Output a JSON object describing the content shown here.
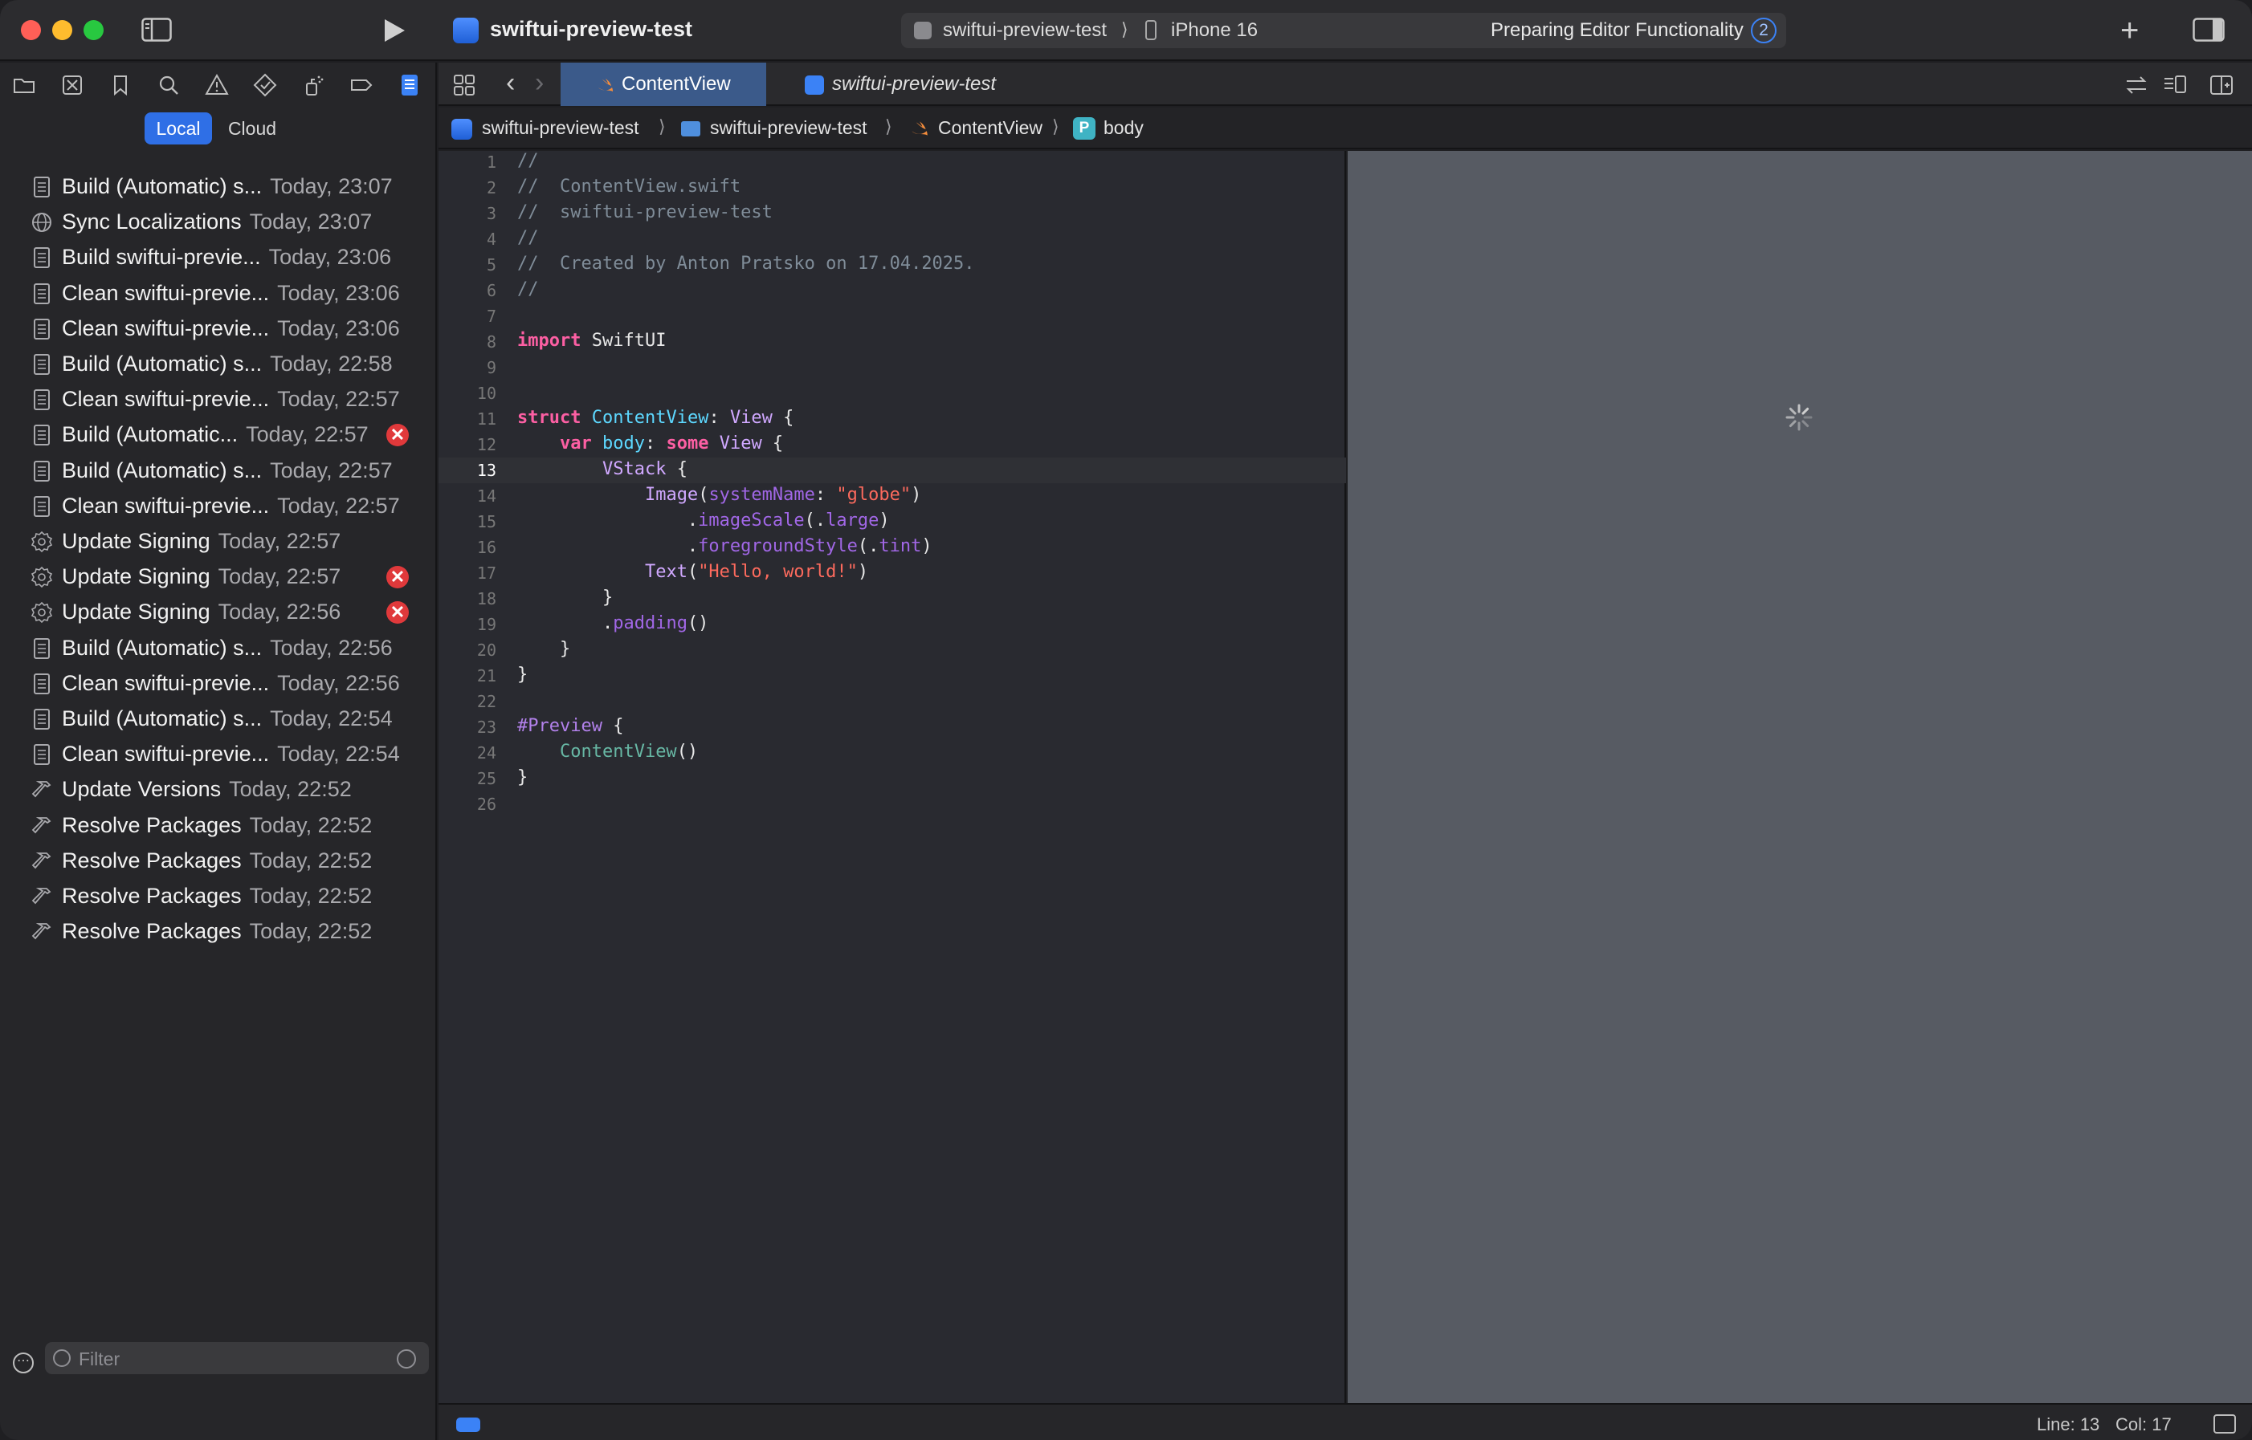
{
  "titlebar": {
    "project_title": "swiftui-preview-test",
    "scheme": "swiftui-preview-test",
    "scheme_separator": "⟩",
    "device": "iPhone 16",
    "status": "Preparing Editor Functionality",
    "status_count": "2",
    "add_symbol": "+"
  },
  "navigator": {
    "segments": {
      "local": "Local",
      "cloud": "Cloud"
    },
    "reports": [
      {
        "title": "Build (Automatic) s...",
        "time": "Today, 23:07",
        "icon": "document-icon",
        "error": false
      },
      {
        "title": "Sync Localizations",
        "time": "Today, 23:07",
        "icon": "globe-icon",
        "error": false
      },
      {
        "title": "Build swiftui-previe...",
        "time": "Today, 23:06",
        "icon": "document-icon",
        "error": false
      },
      {
        "title": "Clean swiftui-previe...",
        "time": "Today, 23:06",
        "icon": "document-icon",
        "error": false
      },
      {
        "title": "Clean swiftui-previe...",
        "time": "Today, 23:06",
        "icon": "document-icon",
        "error": false
      },
      {
        "title": "Build (Automatic) s...",
        "time": "Today, 22:58",
        "icon": "document-icon",
        "error": false
      },
      {
        "title": "Clean swiftui-previe...",
        "time": "Today, 22:57",
        "icon": "document-icon",
        "error": false
      },
      {
        "title": "Build (Automatic...",
        "time": "Today, 22:57",
        "icon": "document-icon",
        "error": true
      },
      {
        "title": "Build (Automatic) s...",
        "time": "Today, 22:57",
        "icon": "document-icon",
        "error": false
      },
      {
        "title": "Clean swiftui-previe...",
        "time": "Today, 22:57",
        "icon": "document-icon",
        "error": false
      },
      {
        "title": "Update Signing",
        "time": "Today, 22:57",
        "icon": "gear-badge-icon",
        "error": false
      },
      {
        "title": "Update Signing",
        "time": "Today, 22:57",
        "icon": "gear-badge-icon",
        "error": true
      },
      {
        "title": "Update Signing",
        "time": "Today, 22:56",
        "icon": "gear-badge-icon",
        "error": true
      },
      {
        "title": "Build (Automatic) s...",
        "time": "Today, 22:56",
        "icon": "document-icon",
        "error": false
      },
      {
        "title": "Clean swiftui-previe...",
        "time": "Today, 22:56",
        "icon": "document-icon",
        "error": false
      },
      {
        "title": "Build (Automatic) s...",
        "time": "Today, 22:54",
        "icon": "document-icon",
        "error": false
      },
      {
        "title": "Clean swiftui-previe...",
        "time": "Today, 22:54",
        "icon": "document-icon",
        "error": false
      },
      {
        "title": "Update Versions",
        "time": "Today, 22:52",
        "icon": "hammer-icon",
        "error": false
      },
      {
        "title": "Resolve Packages",
        "time": "Today, 22:52",
        "icon": "hammer-icon",
        "error": false
      },
      {
        "title": "Resolve Packages",
        "time": "Today, 22:52",
        "icon": "hammer-icon",
        "error": false
      },
      {
        "title": "Resolve Packages",
        "time": "Today, 22:52",
        "icon": "hammer-icon",
        "error": false
      },
      {
        "title": "Resolve Packages",
        "time": "Today, 22:52",
        "icon": "hammer-icon",
        "error": false
      }
    ],
    "filter_placeholder": "Filter",
    "filter_options_symbol": "⋯",
    "error_symbol": "✕"
  },
  "editor": {
    "tabs": {
      "active": "ContentView",
      "second": "swiftui-preview-test"
    },
    "jumpbar": {
      "project": "swiftui-preview-test",
      "folder": "swiftui-preview-test",
      "file": "ContentView",
      "symbol_badge": "P",
      "symbol": "body",
      "separator": "⟩"
    },
    "current_line": 13,
    "code": [
      [
        {
          "t": "//",
          "c": "cm"
        }
      ],
      [
        {
          "t": "//  ContentView.swift",
          "c": "cm"
        }
      ],
      [
        {
          "t": "//  swiftui-preview-test",
          "c": "cm"
        }
      ],
      [
        {
          "t": "//",
          "c": "cm"
        }
      ],
      [
        {
          "t": "//  Created by Anton Pratsko on 17.04.2025.",
          "c": "cm"
        }
      ],
      [
        {
          "t": "//",
          "c": "cm"
        }
      ],
      [],
      [
        {
          "t": "import",
          "c": "kw"
        },
        {
          "t": " SwiftUI",
          "c": ""
        }
      ],
      [],
      [],
      [
        {
          "t": "struct",
          "c": "kw"
        },
        {
          "t": " ",
          "c": ""
        },
        {
          "t": "ContentView",
          "c": "tyn"
        },
        {
          "t": ": ",
          "c": ""
        },
        {
          "t": "View",
          "c": "ty"
        },
        {
          "t": " {",
          "c": ""
        }
      ],
      [
        {
          "t": "    ",
          "c": ""
        },
        {
          "t": "var",
          "c": "kw"
        },
        {
          "t": " ",
          "c": ""
        },
        {
          "t": "body",
          "c": "tyn"
        },
        {
          "t": ": ",
          "c": ""
        },
        {
          "t": "some",
          "c": "kw"
        },
        {
          "t": " ",
          "c": ""
        },
        {
          "t": "View",
          "c": "ty"
        },
        {
          "t": " {",
          "c": ""
        }
      ],
      [
        {
          "t": "        ",
          "c": ""
        },
        {
          "t": "VStack",
          "c": "ty"
        },
        {
          "t": " {",
          "c": ""
        }
      ],
      [
        {
          "t": "            ",
          "c": ""
        },
        {
          "t": "Image",
          "c": "ty"
        },
        {
          "t": "(",
          "c": ""
        },
        {
          "t": "systemName",
          "c": "mb"
        },
        {
          "t": ": ",
          "c": ""
        },
        {
          "t": "\"globe\"",
          "c": "st"
        },
        {
          "t": ")",
          "c": ""
        }
      ],
      [
        {
          "t": "                .",
          "c": ""
        },
        {
          "t": "imageScale",
          "c": "mb"
        },
        {
          "t": "(.",
          "c": ""
        },
        {
          "t": "large",
          "c": "mb"
        },
        {
          "t": ")",
          "c": ""
        }
      ],
      [
        {
          "t": "                .",
          "c": ""
        },
        {
          "t": "foregroundStyle",
          "c": "mb"
        },
        {
          "t": "(.",
          "c": ""
        },
        {
          "t": "tint",
          "c": "mb"
        },
        {
          "t": ")",
          "c": ""
        }
      ],
      [
        {
          "t": "            ",
          "c": ""
        },
        {
          "t": "Text",
          "c": "ty"
        },
        {
          "t": "(",
          "c": ""
        },
        {
          "t": "\"Hello, world!\"",
          "c": "st"
        },
        {
          "t": ")",
          "c": ""
        }
      ],
      [
        {
          "t": "        }",
          "c": ""
        }
      ],
      [
        {
          "t": "        .",
          "c": ""
        },
        {
          "t": "padding",
          "c": "mb"
        },
        {
          "t": "()",
          "c": ""
        }
      ],
      [
        {
          "t": "    }",
          "c": ""
        }
      ],
      [
        {
          "t": "}",
          "c": ""
        }
      ],
      [],
      [
        {
          "t": "#Preview",
          "c": "at"
        },
        {
          "t": " {",
          "c": ""
        }
      ],
      [
        {
          "t": "    ",
          "c": ""
        },
        {
          "t": "ContentView",
          "c": "fn"
        },
        {
          "t": "()",
          "c": ""
        }
      ],
      [
        {
          "t": "}",
          "c": ""
        }
      ],
      []
    ]
  },
  "statusbar": {
    "line": "Line: 13",
    "col": "Col: 17"
  },
  "colors": {
    "accent": "#2f6fe6",
    "error": "#e0393b",
    "preview_canvas": "#575b63"
  }
}
